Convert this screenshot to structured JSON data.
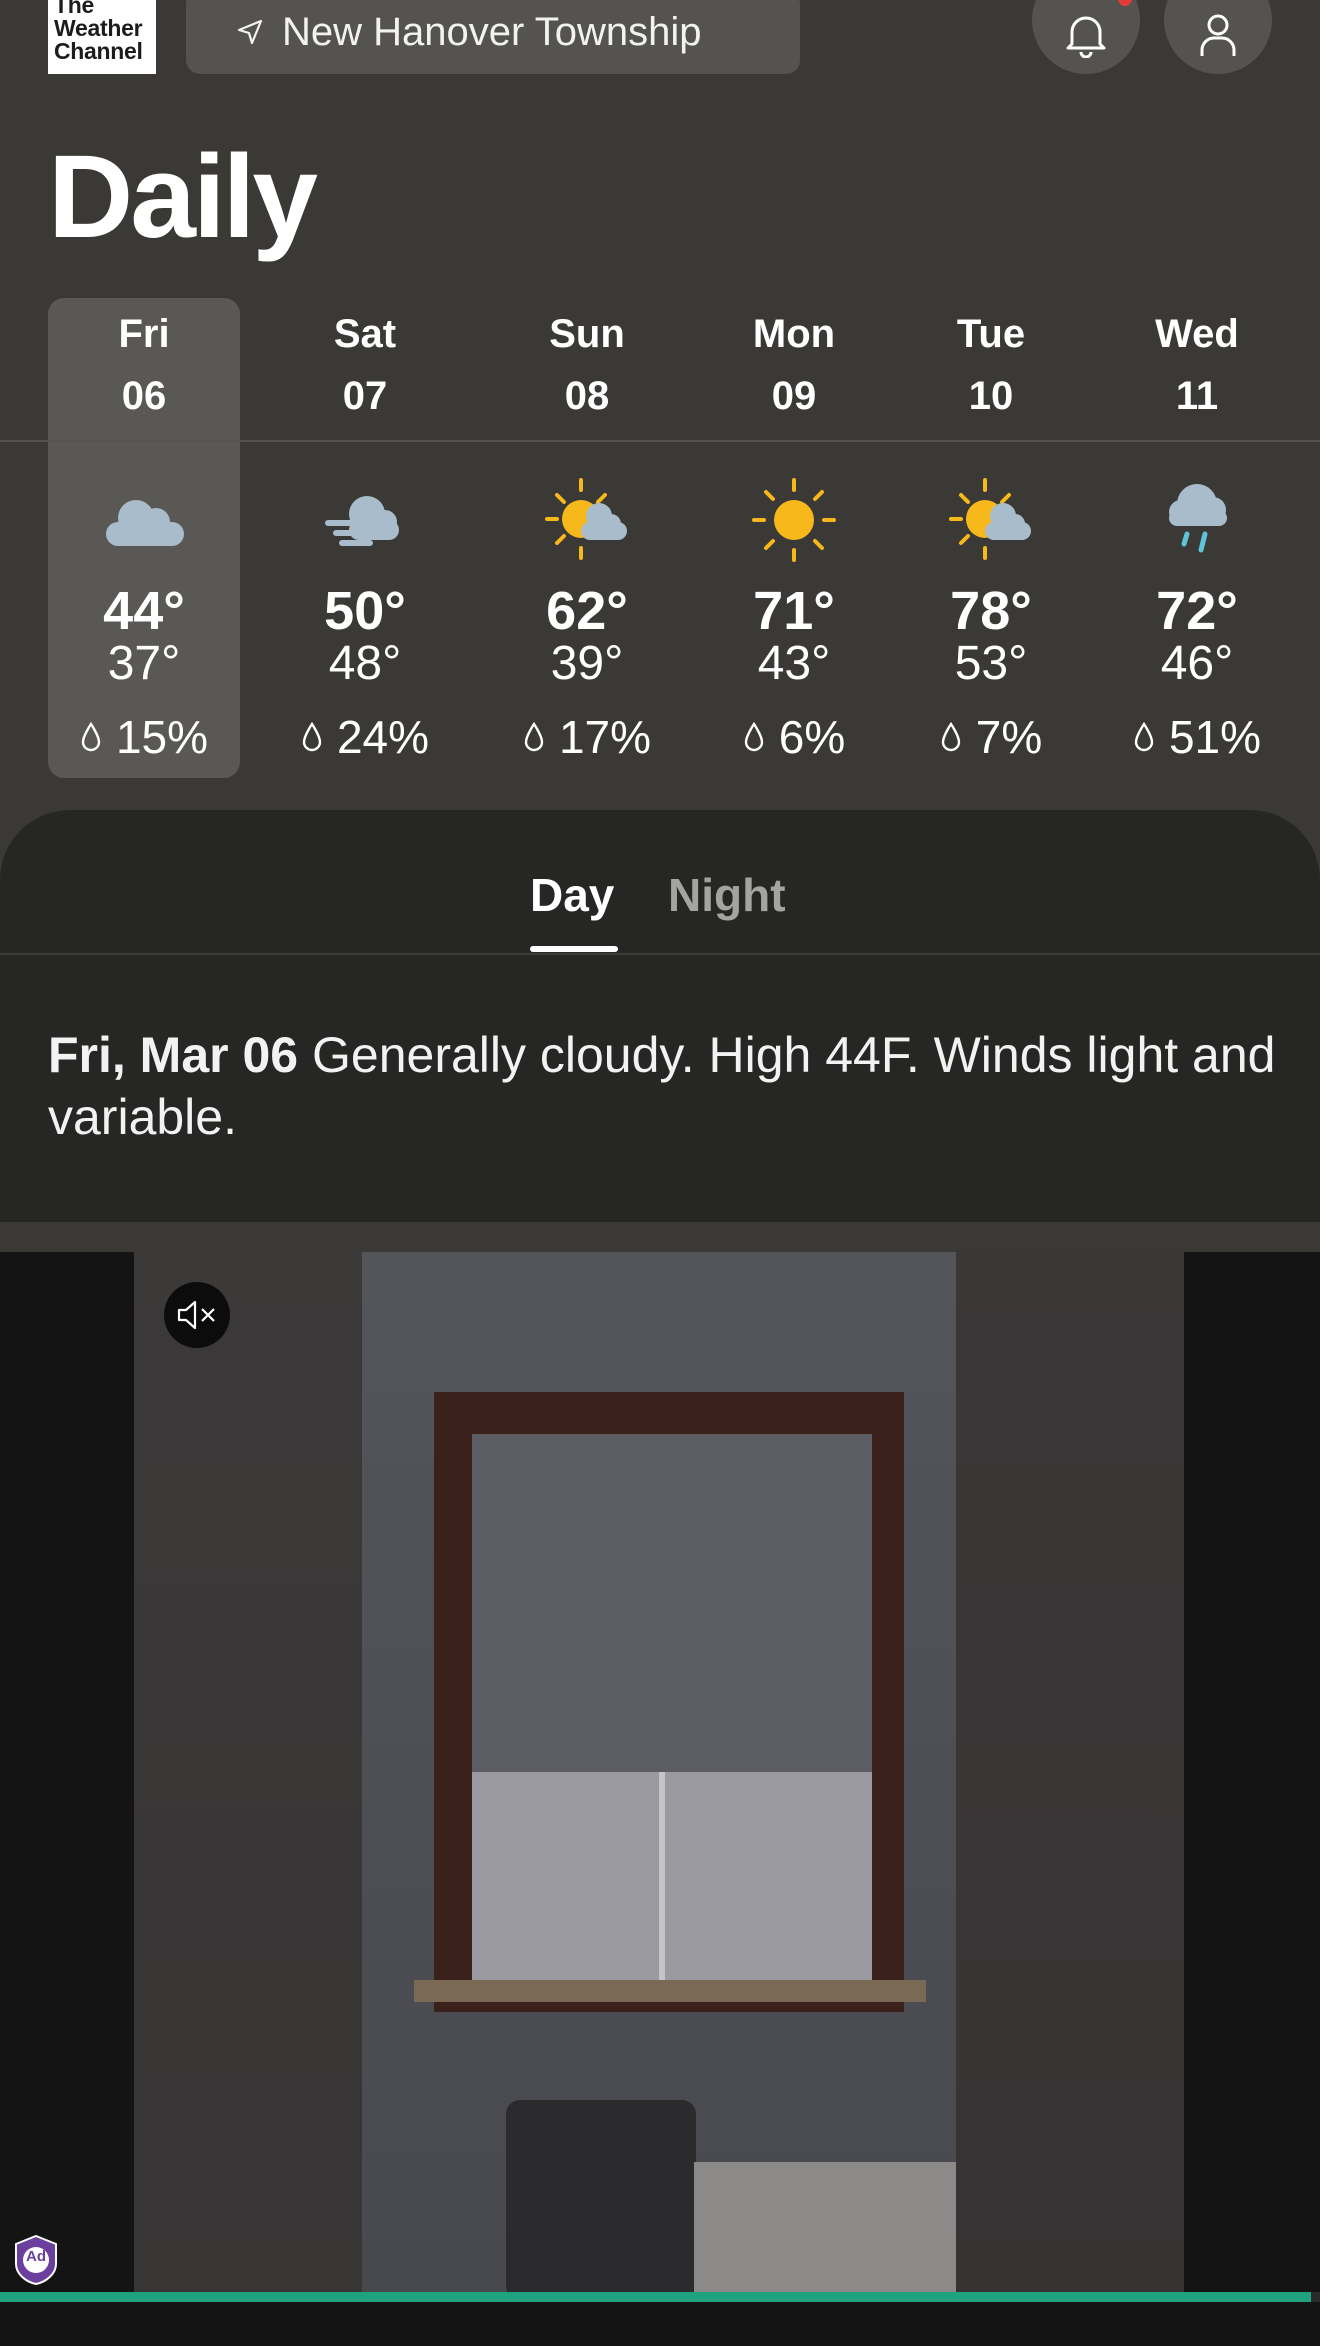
{
  "app": {
    "logo_lines": [
      "The",
      "Weather",
      "Channel"
    ],
    "location": "New Hanover Township",
    "page_title": "Daily"
  },
  "days": [
    {
      "day": "Fri",
      "date": "06",
      "icon": "cloudy-icon",
      "high": "44°",
      "low": "37°",
      "precip": "15%",
      "selected": true
    },
    {
      "day": "Sat",
      "date": "07",
      "icon": "windy-cloud-icon",
      "high": "50°",
      "low": "48°",
      "precip": "24%",
      "selected": false
    },
    {
      "day": "Sun",
      "date": "08",
      "icon": "partly-cloudy-icon",
      "high": "62°",
      "low": "39°",
      "precip": "17%",
      "selected": false
    },
    {
      "day": "Mon",
      "date": "09",
      "icon": "sunny-icon",
      "high": "71°",
      "low": "43°",
      "precip": "6%",
      "selected": false
    },
    {
      "day": "Tue",
      "date": "10",
      "icon": "partly-cloudy-icon",
      "high": "78°",
      "low": "53°",
      "precip": "7%",
      "selected": false
    },
    {
      "day": "Wed",
      "date": "11",
      "icon": "rain-icon",
      "high": "72°",
      "low": "46°",
      "precip": "51%",
      "selected": false
    }
  ],
  "tabs": {
    "day": "Day",
    "night": "Night",
    "active": "day"
  },
  "detail": {
    "date": "Fri, Mar 06",
    "text": " Generally cloudy. High 44F. Winds light and variable."
  },
  "ad": {
    "badge": "Ad",
    "mute_icon": "speaker-muted-icon",
    "progress": 0.993
  },
  "colors": {
    "background": "#3a3936",
    "sheet": "#262624",
    "selected_day": "#5a5855",
    "sun": "#f7b81c",
    "cloud": "#a8bccb",
    "progress": "#1fa37f",
    "notification": "#e23b3b"
  }
}
